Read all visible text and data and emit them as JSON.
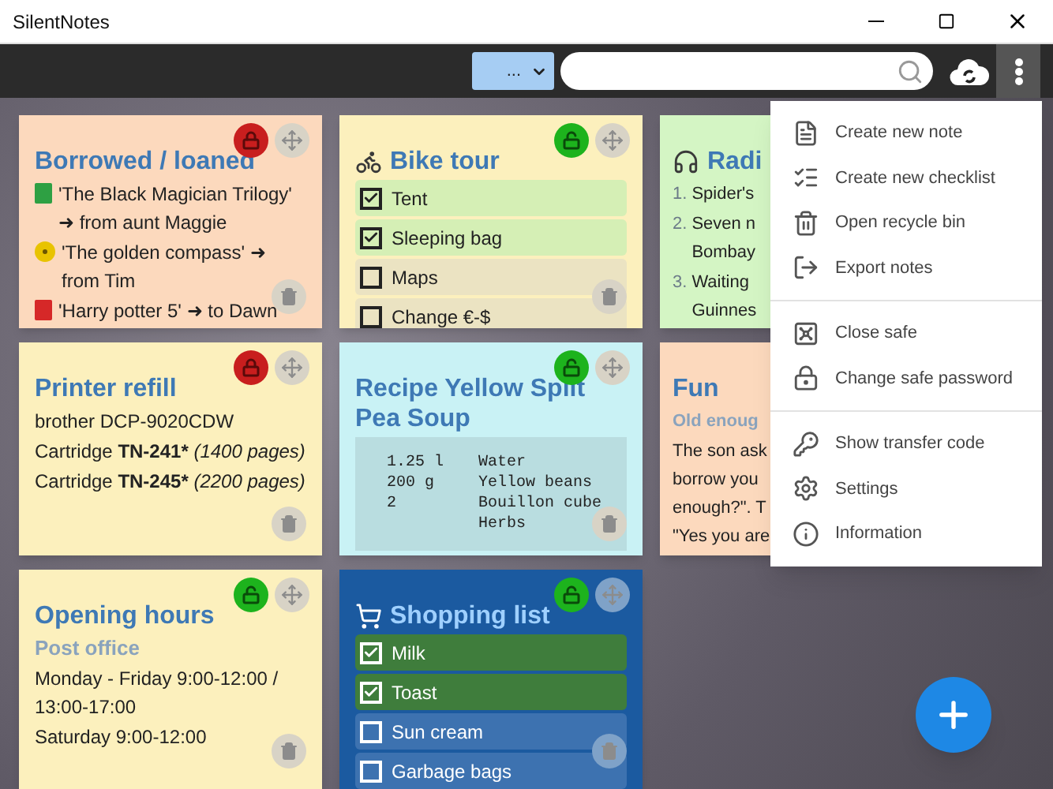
{
  "window": {
    "title": "SilentNotes"
  },
  "toolbar": {
    "filter_button": "..."
  },
  "notes": [
    {
      "title": "Borrowed / loaned",
      "locked": true,
      "color": "#fcd9bd",
      "kind": "text",
      "blocks": [
        {
          "kind": "book",
          "color": "#2ea043",
          "segments": [
            {
              "text": "'The Black Magician Trilogy' ➜ from aunt Maggie"
            }
          ]
        },
        {
          "kind": "disc",
          "color": "#e8c300",
          "segments": [
            {
              "text": "'The golden compass' ➜ from Tim"
            }
          ]
        },
        {
          "kind": "book",
          "color": "#d62828",
          "segments": [
            {
              "text": "'Harry potter 5' ➜ to Dawn"
            }
          ]
        }
      ]
    },
    {
      "title": "Bike tour",
      "locked": false,
      "color": "#fcf0bd",
      "kind": "checklist",
      "items": [
        {
          "text": "Tent",
          "checked": true
        },
        {
          "text": "Sleeping bag",
          "checked": true
        },
        {
          "text": "Maps",
          "checked": false
        },
        {
          "text": "Change €-$",
          "checked": false
        }
      ]
    },
    {
      "title": "Radi",
      "color": "#d4f5c4",
      "kind": "text",
      "blocks": [
        {
          "kind": "numbered",
          "number": "1.",
          "text_lines": [
            "Spider's"
          ]
        },
        {
          "kind": "numbered",
          "number": "2.",
          "text_lines": [
            "Seven n",
            "Bombay"
          ]
        },
        {
          "kind": "numbered",
          "number": "3.",
          "text_lines": [
            "Waiting",
            "Guinnes"
          ]
        }
      ]
    },
    {
      "title": "Printer refill",
      "locked": true,
      "color": "#fcf0bd",
      "kind": "text",
      "blocks": [
        {
          "kind": "paragraph",
          "segments": [
            {
              "text": "brother DCP-9020CDW"
            }
          ]
        },
        {
          "kind": "paragraph",
          "segments": [
            {
              "text": "Cartridge "
            },
            {
              "text": "TN-241*",
              "bold": true
            },
            {
              "text": " (1400 pages)",
              "italic": true
            }
          ]
        },
        {
          "kind": "paragraph",
          "segments": [
            {
              "text": "Cartridge "
            },
            {
              "text": "TN-245*",
              "bold": true
            },
            {
              "text": " (2200 pages)",
              "italic": true
            }
          ]
        }
      ]
    },
    {
      "title": "Recipe Yellow Split Pea Soup",
      "locked": false,
      "color": "#c9f2f5",
      "kind": "code",
      "rows": [
        {
          "quantity": "1.25 l",
          "ingredient": "Water"
        },
        {
          "quantity": "200 g",
          "ingredient": "Yellow beans"
        },
        {
          "quantity": "2",
          "ingredient": "Bouillon cube"
        },
        {
          "ingredient": "Herbs"
        }
      ]
    },
    {
      "title": "Fun",
      "color": "#fcd9bd",
      "kind": "text",
      "blocks": [
        {
          "kind": "heading",
          "text": "Old enoug"
        },
        {
          "kind": "lines",
          "text_lines": [
            "The son ask",
            "borrow you",
            "enough?\". T",
            "\"Yes you are"
          ]
        }
      ]
    },
    {
      "title": "Opening hours",
      "locked": false,
      "color": "#fcf0bd",
      "kind": "text",
      "blocks": [
        {
          "kind": "heading",
          "text": "Post office"
        },
        {
          "kind": "paragraph",
          "segments": [
            {
              "text": "Monday - Friday 9:00-12:00 / 13:00-17:00"
            }
          ]
        },
        {
          "kind": "paragraph",
          "segments": [
            {
              "text": "Saturday 9:00-12:00"
            }
          ]
        }
      ]
    },
    {
      "title": "Shopping list",
      "locked": false,
      "color": "#1b5aa0",
      "dark": true,
      "kind": "checklist",
      "items": [
        {
          "text": "Milk",
          "checked": true
        },
        {
          "text": "Toast",
          "checked": true
        },
        {
          "text": "Sun cream",
          "checked": false
        },
        {
          "text": "Garbage bags",
          "checked": false
        }
      ]
    }
  ],
  "menu": {
    "groups": [
      [
        {
          "label": "Create new note"
        },
        {
          "label": "Create new checklist"
        },
        {
          "label": "Open recycle bin"
        },
        {
          "label": "Export notes"
        }
      ],
      [
        {
          "label": "Close safe"
        },
        {
          "label": "Change safe password"
        }
      ],
      [
        {
          "label": "Show transfer code"
        },
        {
          "label": "Settings"
        },
        {
          "label": "Information"
        }
      ]
    ]
  }
}
